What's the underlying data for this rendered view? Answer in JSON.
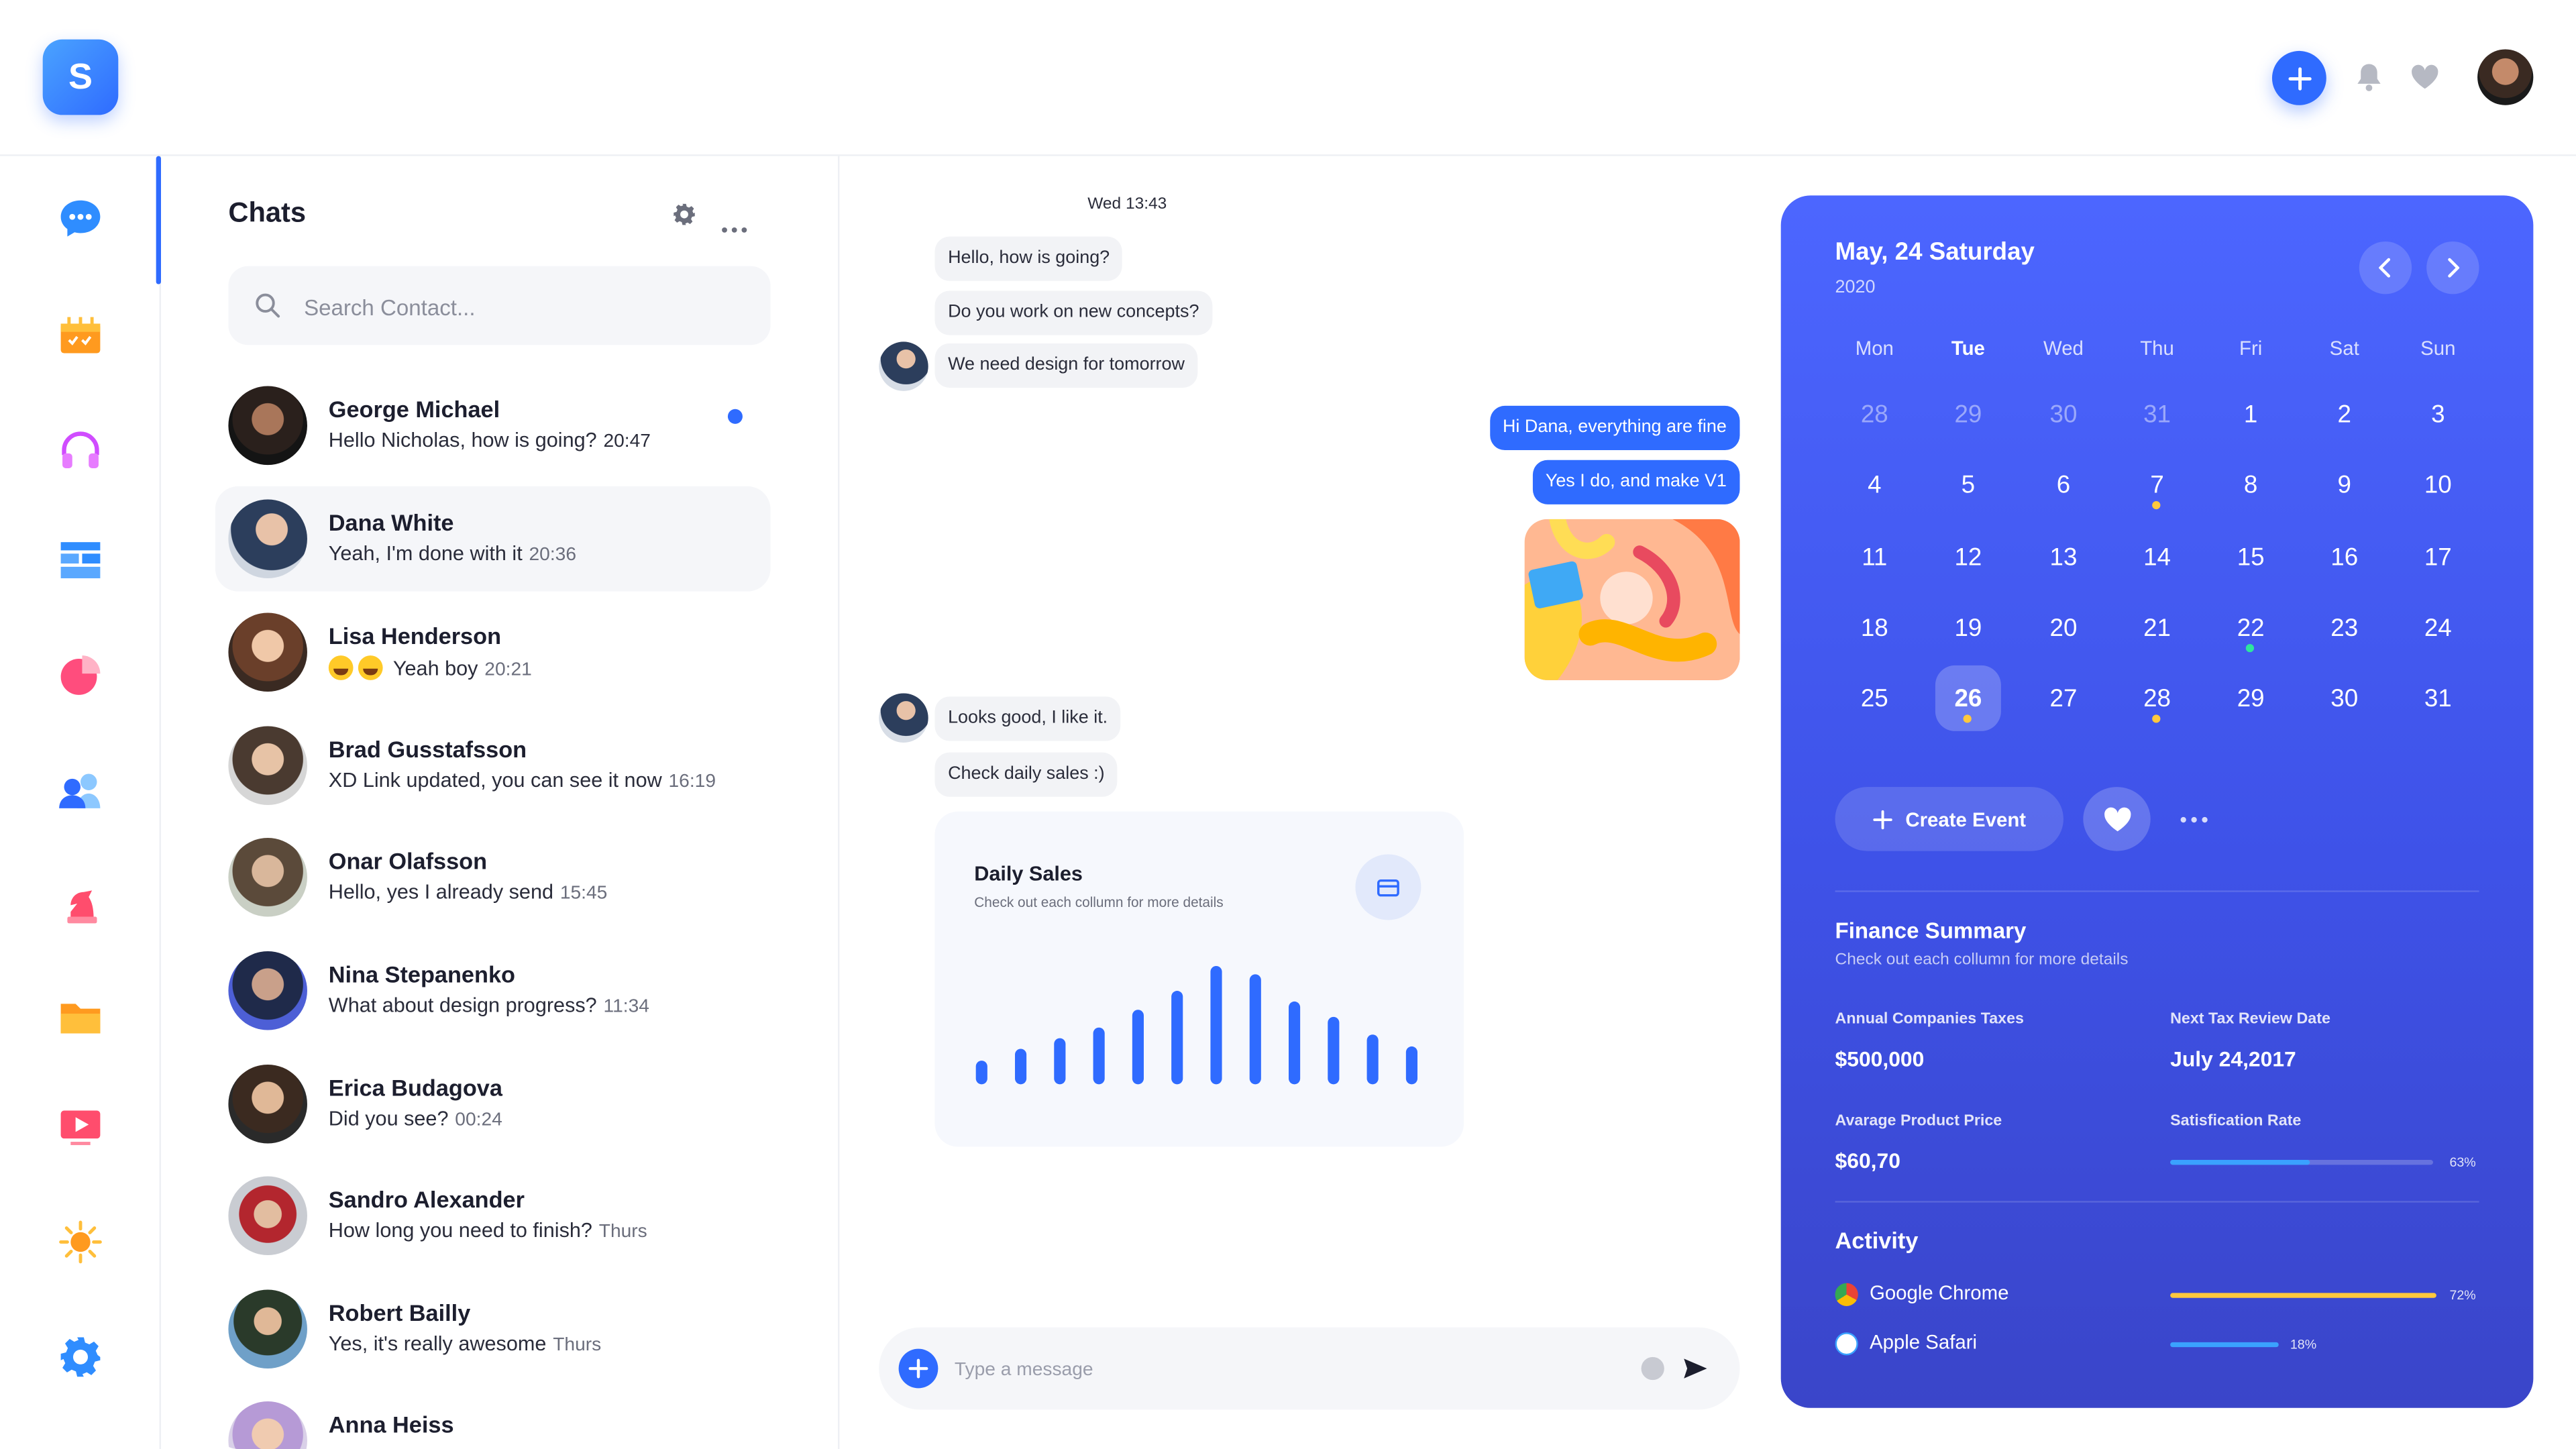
{
  "app": {
    "logo_letter": "S",
    "accent": "#2f6bff"
  },
  "topbar": {
    "add_icon": "plus-icon",
    "bell_icon": "bell-icon",
    "heart_icon": "heart-icon"
  },
  "nav": [
    {
      "icon": "chat-bubble-icon"
    },
    {
      "icon": "calendar-icon"
    },
    {
      "icon": "headphones-icon"
    },
    {
      "icon": "layout-icon"
    },
    {
      "icon": "pie-chart-icon"
    },
    {
      "icon": "users-icon"
    },
    {
      "icon": "chess-knight-icon"
    },
    {
      "icon": "folder-icon"
    },
    {
      "icon": "video-player-icon"
    },
    {
      "icon": "sun-icon"
    },
    {
      "icon": "settings-gear-icon"
    }
  ],
  "chats": {
    "title": "Chats",
    "search_placeholder": "Search Contact...",
    "contacts": [
      {
        "name": "George Michael",
        "message": "Hello Nicholas, how is going?",
        "time": "20:47",
        "unread": true
      },
      {
        "name": "Dana White",
        "message": "Yeah, I'm done with it",
        "time": "20:36",
        "selected": true
      },
      {
        "name": "Lisa Henderson",
        "message": "Yeah boy",
        "time": "20:21",
        "emoji_prefix": 2
      },
      {
        "name": "Brad Gusstafsson",
        "message": "XD Link updated, you can see it now",
        "time": "16:19"
      },
      {
        "name": "Onar Olafsson",
        "message": "Hello, yes I already send",
        "time": "15:45"
      },
      {
        "name": "Nina Stepanenko",
        "message": "What about design progress?",
        "time": "11:34"
      },
      {
        "name": "Erica Budagova",
        "message": "Did you see?",
        "time": "00:24"
      },
      {
        "name": "Sandro Alexander",
        "message": "How long you need to finish?",
        "time": "Thurs"
      },
      {
        "name": "Robert Bailly",
        "message": "Yes, it's really awesome",
        "time": "Thurs"
      },
      {
        "name": "Anna Heiss",
        "message": "",
        "time": ""
      }
    ]
  },
  "conversation": {
    "timestamp": "Wed 13:43",
    "messages": [
      {
        "text": "Hello, how is going?",
        "dir": "in"
      },
      {
        "text": "Do you work on new concepts?",
        "dir": "in"
      },
      {
        "text": "We need design for tomorrow",
        "dir": "in"
      },
      {
        "text": "Hi Dana, everything are fine",
        "dir": "out"
      },
      {
        "text": "Yes I do, and make V1",
        "dir": "out"
      },
      {
        "text": "Looks good, I like it.",
        "dir": "in"
      },
      {
        "text": "Check daily sales :)",
        "dir": "in"
      }
    ],
    "sales_card": {
      "title": "Daily Sales",
      "subtitle": "Check out each collumn for more details",
      "icon": "card-icon",
      "bar_values": [
        0.2,
        0.3,
        0.39,
        0.48,
        0.63,
        0.79,
        1.0,
        0.93,
        0.7,
        0.57,
        0.42,
        0.32
      ]
    },
    "composer_placeholder": "Type a message"
  },
  "calendar": {
    "title": "May, 24 Saturday",
    "year": "2020",
    "weekdays": [
      "Mon",
      "Tue",
      "Wed",
      "Thu",
      "Fri",
      "Sat",
      "Sun"
    ],
    "highlight_weekday": "Tue",
    "weeks": [
      [
        "28",
        "29",
        "30",
        "31",
        "1",
        "2",
        "3"
      ],
      [
        "4",
        "5",
        "6",
        "7",
        "8",
        "9",
        "10"
      ],
      [
        "11",
        "12",
        "13",
        "14",
        "15",
        "16",
        "17"
      ],
      [
        "18",
        "19",
        "20",
        "21",
        "22",
        "23",
        "24"
      ],
      [
        "25",
        "26",
        "27",
        "28",
        "29",
        "30",
        "31"
      ]
    ],
    "muted_days_first_row": 4,
    "selected_day": "26",
    "event_dots": [
      {
        "week": 1,
        "col": 3,
        "color": "#ffc83d"
      },
      {
        "week": 3,
        "col": 4,
        "color": "#2ee59d"
      },
      {
        "week": 4,
        "col": 1,
        "color": "#ffc83d"
      },
      {
        "week": 4,
        "col": 3,
        "color": "#ffc83d"
      }
    ],
    "create_event_label": "Create Event"
  },
  "finance": {
    "title": "Finance Summary",
    "subtitle": "Check out each collumn for more details",
    "annual_taxes_label": "Annual Companies Taxes",
    "annual_taxes_value": "$500,000",
    "next_review_label": "Next Tax Review Date",
    "next_review_value": "July 24,2017",
    "avg_price_label": "Avarage Product Price",
    "avg_price_value": "$60,70",
    "satisfaction_label": "Satisfication Rate",
    "satisfaction_pct": "63%",
    "satisfaction_value": 0.53
  },
  "activity": {
    "title": "Activity",
    "items": [
      {
        "name": "Google Chrome",
        "pct": "72%",
        "value": 1.0,
        "color": "#ffc83d"
      },
      {
        "name": "Apple Safari",
        "pct": "18%",
        "value": 0.41,
        "color": "#3aa2ff"
      }
    ]
  }
}
